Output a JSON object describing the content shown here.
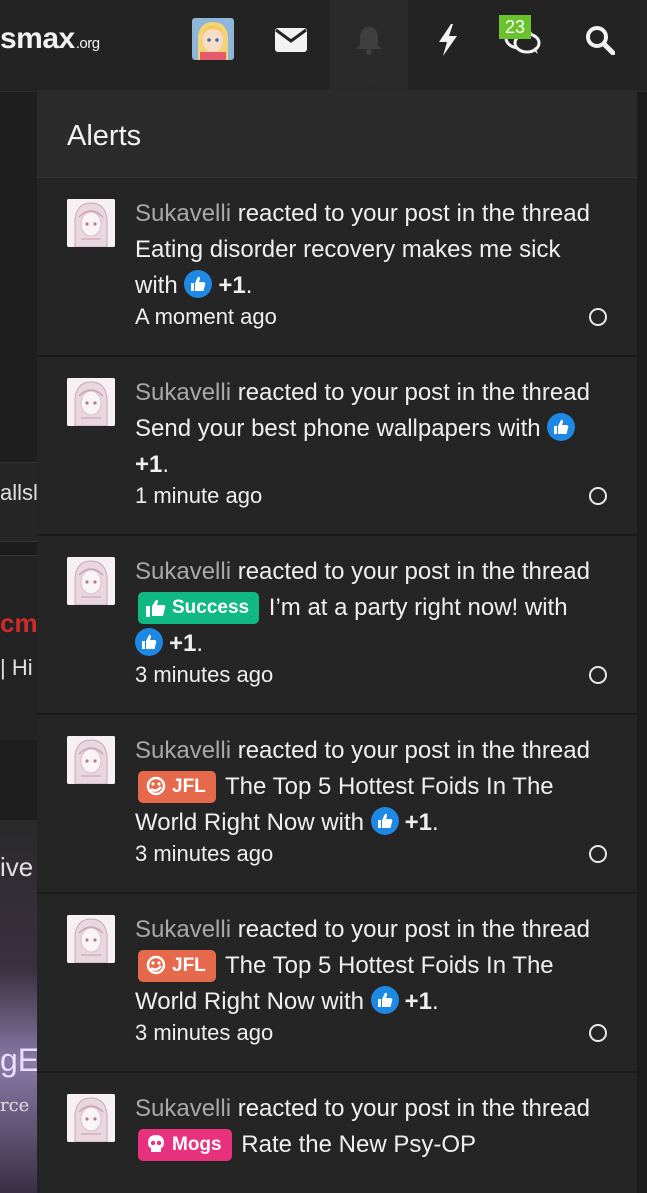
{
  "navbar": {
    "logo_main": "smax",
    "logo_tld": ".org",
    "conversations_badge": "23",
    "icons": [
      "avatar",
      "envelope-icon",
      "bell-icon",
      "bolt-icon",
      "chat-icon",
      "search-icon"
    ]
  },
  "background": {
    "text1": "allsl",
    "text2": "cm",
    "text3": "| Hi",
    "text4": "ive",
    "text5": "gE",
    "text6": "rce"
  },
  "alerts_panel": {
    "title": "Alerts",
    "items": [
      {
        "user": "Sukavelli",
        "action": " reacted to your post in the thread ",
        "tag": "",
        "thread": "Eating disorder recovery makes me sick with ",
        "reaction": "+1",
        "time": "A moment ago"
      },
      {
        "user": "Sukavelli",
        "action": " reacted to your post in the thread ",
        "tag": "",
        "thread": "Send your best phone wallpapers with ",
        "reaction": "+1",
        "time": "1 minute ago"
      },
      {
        "user": "Sukavelli",
        "action": " reacted to your post in the thread ",
        "tag": "Success",
        "thread": " I’m at a party right now! with ",
        "reaction": "+1",
        "time": "3 minutes ago"
      },
      {
        "user": "Sukavelli",
        "action": " reacted to your post in the thread ",
        "tag": "JFL",
        "thread": " The Top 5 Hottest Foids In The World Right Now with ",
        "reaction": "+1",
        "time": "3 minutes ago"
      },
      {
        "user": "Sukavelli",
        "action": " reacted to your post in the thread ",
        "tag": "JFL",
        "thread": " The Top 5 Hottest Foids In The World Right Now with ",
        "reaction": "+1",
        "time": "3 minutes ago"
      },
      {
        "user": "Sukavelli",
        "action": " reacted to your post in the thread ",
        "tag": "Mogs",
        "thread": " Rate the New Psy-OP",
        "reaction": "",
        "time": ""
      }
    ]
  },
  "colors": {
    "tag_success": "#10b981",
    "tag_jfl": "#e5694a",
    "tag_mogs": "#e8327d",
    "like_blue": "#1e88e5",
    "badge_green": "#6ac32c"
  }
}
